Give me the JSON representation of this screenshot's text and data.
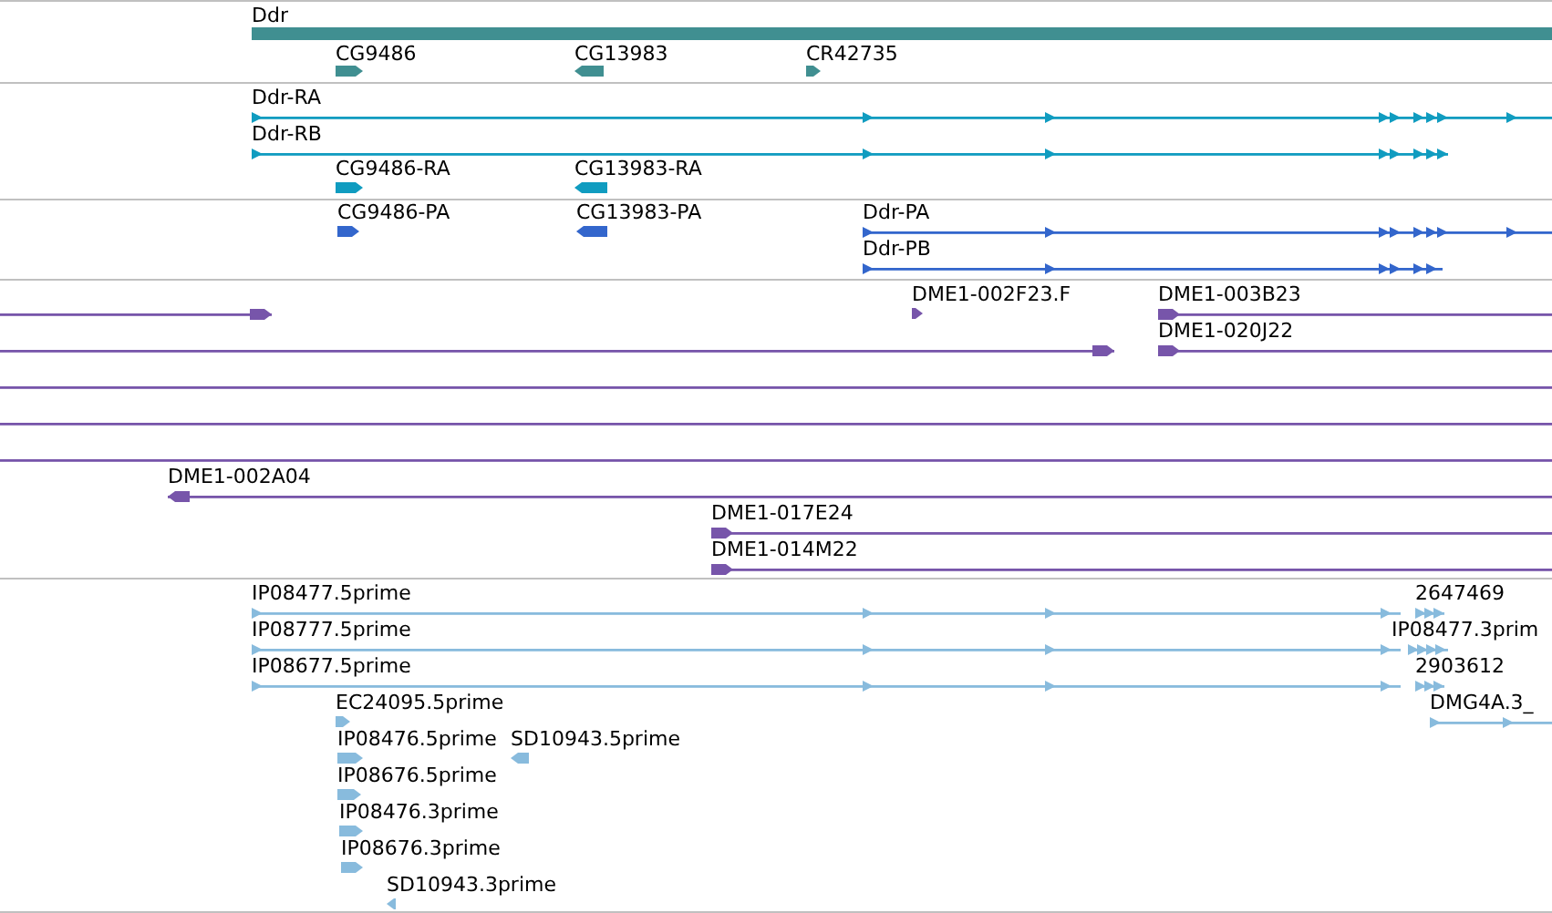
{
  "tracks": [
    {
      "color": "#408f91",
      "features": [
        {
          "kind": "span",
          "label": "Ddr"
        },
        {
          "kind": "block",
          "label": "CG9486",
          "reverse": false
        },
        {
          "kind": "block",
          "label": "CG13983",
          "reverse": true
        },
        {
          "kind": "block",
          "label": "CR42735",
          "reverse": false
        }
      ]
    },
    {
      "color": "#109cc0",
      "features": [
        {
          "kind": "transcript",
          "label": "Ddr-RA",
          "reverse": false
        },
        {
          "kind": "transcript",
          "label": "Ddr-RB",
          "reverse": false
        },
        {
          "kind": "block",
          "label": "CG9486-RA",
          "reverse": false
        },
        {
          "kind": "block",
          "label": "CG13983-RA",
          "reverse": true
        }
      ]
    },
    {
      "color": "#3366cc",
      "features": [
        {
          "kind": "block",
          "label": "CG9486-PA",
          "reverse": false
        },
        {
          "kind": "block",
          "label": "CG13983-PA",
          "reverse": true
        },
        {
          "kind": "transcript",
          "label": "Ddr-PA",
          "reverse": false
        },
        {
          "kind": "transcript",
          "label": "Ddr-PB",
          "reverse": false
        }
      ]
    },
    {
      "color": "#7755aa",
      "features": [
        {
          "kind": "read",
          "reverse": false
        },
        {
          "kind": "block",
          "label": "DME1-002F23.F",
          "reverse": false
        },
        {
          "kind": "read",
          "label": "DME1-003B23",
          "reverse": false
        },
        {
          "kind": "read",
          "reverse": false
        },
        {
          "kind": "read",
          "label": "DME1-020J22",
          "reverse": false
        },
        {
          "kind": "line"
        },
        {
          "kind": "line"
        },
        {
          "kind": "line"
        },
        {
          "kind": "read",
          "label": "DME1-002A04",
          "reverse": true
        },
        {
          "kind": "read",
          "label": "DME1-017E24",
          "reverse": false
        },
        {
          "kind": "read",
          "label": "DME1-014M22",
          "reverse": false
        }
      ]
    },
    {
      "color": "#88bbdd",
      "features": [
        {
          "kind": "transcript",
          "label": "IP08477.5prime",
          "reverse": false
        },
        {
          "kind": "transcript",
          "label": "2647469",
          "reverse": false
        },
        {
          "kind": "transcript",
          "label": "IP08777.5prime",
          "reverse": false
        },
        {
          "kind": "transcript",
          "label": "IP08477.3prim",
          "reverse": false
        },
        {
          "kind": "transcript",
          "label": "IP08677.5prime",
          "reverse": false
        },
        {
          "kind": "transcript",
          "label": "2903612",
          "reverse": false
        },
        {
          "kind": "transcript",
          "label": "DMG4A.3_",
          "reverse": false
        },
        {
          "kind": "block",
          "label": "EC24095.5prime",
          "reverse": false
        },
        {
          "kind": "block",
          "label": "IP08476.5prime",
          "reverse": false
        },
        {
          "kind": "block",
          "label": "SD10943.5prime",
          "reverse": true
        },
        {
          "kind": "block",
          "label": "IP08676.5prime",
          "reverse": false
        },
        {
          "kind": "block",
          "label": "IP08476.3prime",
          "reverse": false
        },
        {
          "kind": "block",
          "label": "IP08676.3prime",
          "reverse": false
        },
        {
          "kind": "block",
          "label": "SD10943.3prime",
          "reverse": true
        }
      ]
    }
  ]
}
